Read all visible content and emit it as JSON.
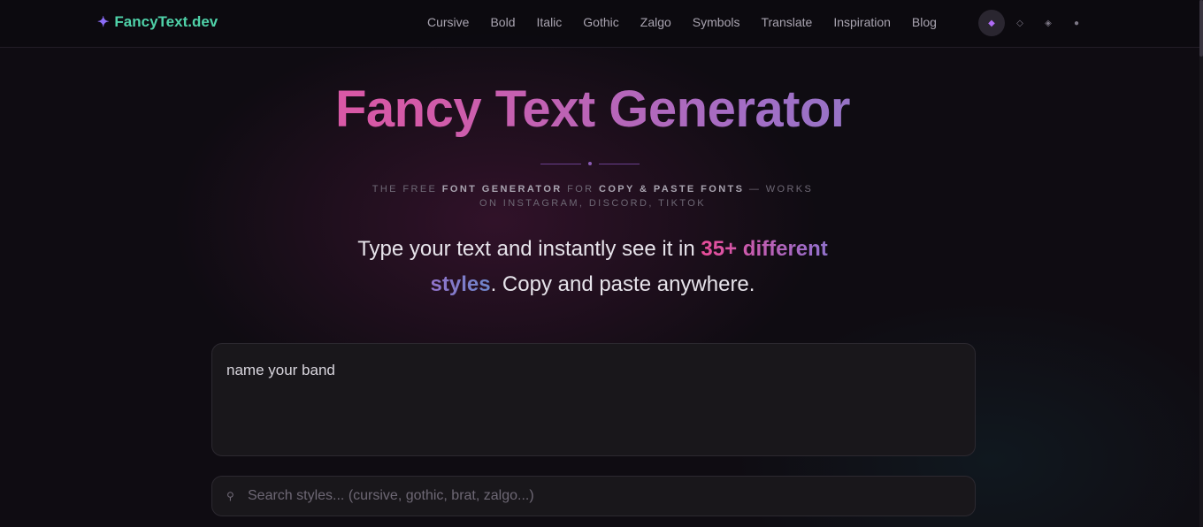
{
  "header": {
    "brand_icon": "sparkle-icon",
    "brand_name": "FancyText.dev",
    "nav": [
      {
        "label": "Cursive"
      },
      {
        "label": "Bold"
      },
      {
        "label": "Italic"
      },
      {
        "label": "Gothic"
      },
      {
        "label": "Zalgo"
      },
      {
        "label": "Symbols"
      },
      {
        "label": "Translate"
      },
      {
        "label": "Inspiration"
      },
      {
        "label": "Blog"
      }
    ],
    "theme_options": [
      {
        "glyph": "◆",
        "icon": "diamond-filled-icon",
        "active": true
      },
      {
        "glyph": "◇",
        "icon": "diamond-outline-icon",
        "active": false
      },
      {
        "glyph": "◈",
        "icon": "diamond-dot-icon",
        "active": false
      },
      {
        "glyph": "●",
        "icon": "circle-icon",
        "active": false
      }
    ]
  },
  "hero": {
    "title": "Fancy Text Generator",
    "tagline_1": "The free ",
    "tagline_2": "font generator",
    "tagline_3": " for ",
    "tagline_4": "copy & paste fonts",
    "tagline_5": " — works on Instagram, Discord, TikTok",
    "lead_1": "Type your text and instantly see it in ",
    "lead_highlight": "35+ different styles",
    "lead_2": ". Copy and paste anywhere."
  },
  "input": {
    "value": "name your band"
  },
  "search": {
    "icon": "pin-icon",
    "placeholder": "Search styles... (cursive, gothic, brat, zalgo...)"
  },
  "colors": {
    "background": "#0f0c12",
    "brand": "#4fd1a8",
    "accent_pink": "#ec4d9a",
    "accent_blue": "#6d86c9"
  }
}
